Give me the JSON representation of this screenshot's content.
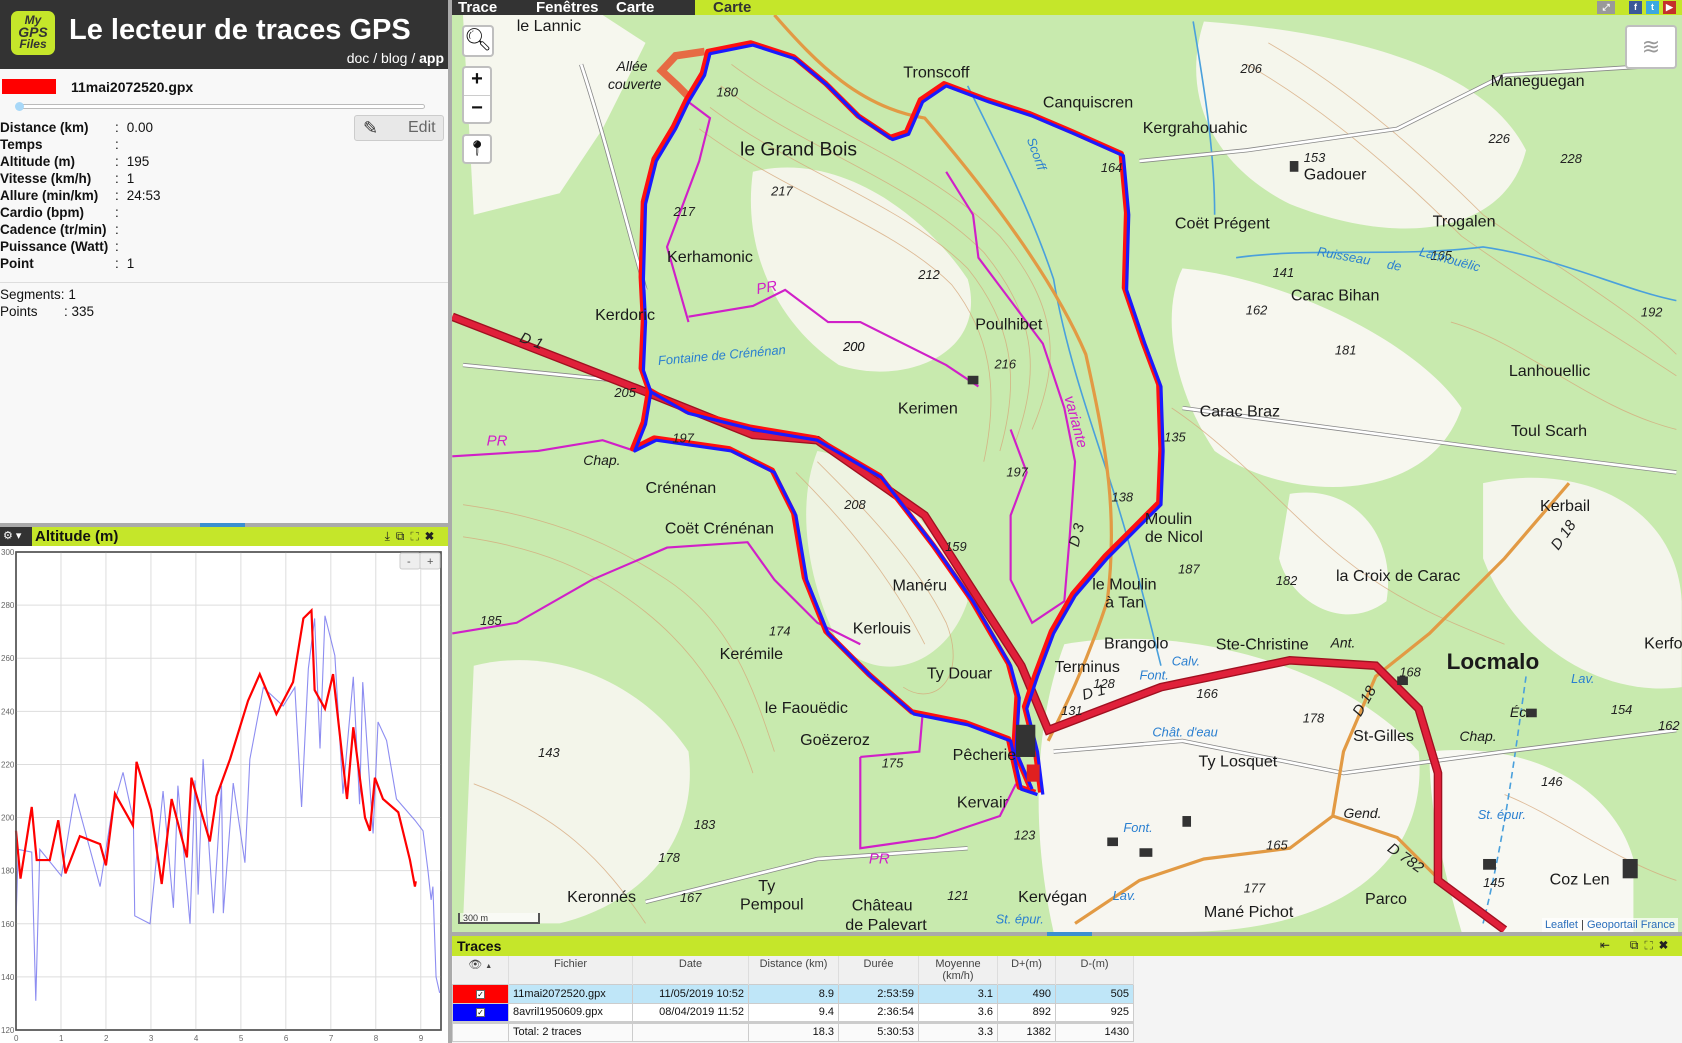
{
  "header": {
    "logo": [
      "My",
      "GPS",
      "Files"
    ],
    "title": "Le lecteur de traces GPS",
    "links": {
      "doc": "doc",
      "blog": "blog",
      "app": "app",
      "sep": "/"
    }
  },
  "track": {
    "filename": "11mai2072520.gpx",
    "color": "#ff0000",
    "edit_label": "Edit",
    "slider_position": 0
  },
  "stats": [
    {
      "label": "Distance (km)",
      "value": "0.00"
    },
    {
      "label": "Temps",
      "value": ""
    },
    {
      "label": "Altitude (m)",
      "value": "195"
    },
    {
      "label": "Vitesse (km/h)",
      "value": "1"
    },
    {
      "label": "Allure (min/km)",
      "value": "24:53"
    },
    {
      "label": "Cardio (bpm)",
      "value": ""
    },
    {
      "label": "Cadence (tr/min)",
      "value": ""
    },
    {
      "label": "Puissance (Watt)",
      "value": ""
    },
    {
      "label": "Point",
      "value": "1"
    }
  ],
  "summary": {
    "segments_label": "Segments",
    "segments": "1",
    "points_label": "Points",
    "points": "335"
  },
  "altitude_panel": {
    "title": "Altitude (m)",
    "zoom_out": "-",
    "zoom_in": "+"
  },
  "chart_data": {
    "type": "line",
    "title": "Altitude (m)",
    "xlabel": "",
    "ylabel": "",
    "xlim": [
      0,
      9.45
    ],
    "ylim": [
      120,
      300
    ],
    "xticks": [
      "0",
      "1",
      "2",
      "3",
      "4",
      "5",
      "6",
      "7",
      "8",
      "9"
    ],
    "yticks": [
      "120",
      "140",
      "160",
      "180",
      "200",
      "220",
      "240",
      "260",
      "280",
      "300"
    ],
    "grid": true,
    "series": [
      {
        "name": "11mai2072520.gpx",
        "color": "#ff0000",
        "points": [
          [
            0,
            195
          ],
          [
            0.1,
            177
          ],
          [
            0.35,
            204
          ],
          [
            0.46,
            184
          ],
          [
            0.75,
            184
          ],
          [
            0.94,
            199
          ],
          [
            1.1,
            179
          ],
          [
            1.42,
            193
          ],
          [
            1.87,
            190
          ],
          [
            2.0,
            182
          ],
          [
            2.2,
            209
          ],
          [
            2.6,
            197
          ],
          [
            2.68,
            221
          ],
          [
            3.0,
            203
          ],
          [
            3.24,
            175
          ],
          [
            3.46,
            207
          ],
          [
            3.8,
            185
          ],
          [
            3.9,
            215
          ],
          [
            4.31,
            191
          ],
          [
            4.46,
            208
          ],
          [
            4.76,
            222
          ],
          [
            5.16,
            244
          ],
          [
            5.42,
            254
          ],
          [
            5.79,
            239
          ],
          [
            6.16,
            251
          ],
          [
            6.39,
            275
          ],
          [
            6.57,
            278
          ],
          [
            6.64,
            248
          ],
          [
            6.87,
            241
          ],
          [
            7.05,
            254
          ],
          [
            7.36,
            207
          ],
          [
            7.5,
            234
          ],
          [
            7.76,
            200
          ],
          [
            7.87,
            195
          ],
          [
            7.98,
            215
          ],
          [
            8.16,
            207
          ],
          [
            8.5,
            202
          ],
          [
            8.76,
            184
          ],
          [
            8.87,
            174
          ],
          [
            8.89,
            176
          ]
        ]
      },
      {
        "name": "8avril1950609.gpx",
        "color": "#7070ee",
        "points": [
          [
            0,
            161
          ],
          [
            0.05,
            188
          ],
          [
            0.35,
            187
          ],
          [
            0.44,
            131
          ],
          [
            0.53,
            188
          ],
          [
            1.01,
            178
          ],
          [
            1.31,
            209
          ],
          [
            1.87,
            174
          ],
          [
            2.13,
            202
          ],
          [
            2.38,
            217
          ],
          [
            2.61,
            199
          ],
          [
            2.64,
            163
          ],
          [
            2.98,
            160
          ],
          [
            3.27,
            210
          ],
          [
            3.5,
            166
          ],
          [
            3.6,
            212
          ],
          [
            3.87,
            160
          ],
          [
            3.98,
            214
          ],
          [
            4.05,
            171
          ],
          [
            4.16,
            222
          ],
          [
            4.39,
            164
          ],
          [
            4.57,
            212
          ],
          [
            4.61,
            164
          ],
          [
            4.83,
            213
          ],
          [
            5.09,
            183
          ],
          [
            5.2,
            222
          ],
          [
            5.5,
            249
          ],
          [
            5.94,
            242
          ],
          [
            6.2,
            249
          ],
          [
            6.35,
            204
          ],
          [
            6.5,
            256
          ],
          [
            6.64,
            275
          ],
          [
            6.76,
            226
          ],
          [
            6.87,
            276
          ],
          [
            7.09,
            261
          ],
          [
            7.27,
            209
          ],
          [
            7.5,
            253
          ],
          [
            7.64,
            205
          ],
          [
            7.71,
            251
          ],
          [
            7.94,
            194
          ],
          [
            8.05,
            236
          ],
          [
            8.24,
            229
          ],
          [
            8.46,
            207
          ],
          [
            8.87,
            199
          ],
          [
            9.05,
            195
          ],
          [
            9.16,
            180
          ],
          [
            9.23,
            169
          ],
          [
            9.27,
            174
          ],
          [
            9.34,
            140
          ],
          [
            9.42,
            134
          ]
        ]
      }
    ]
  },
  "menu": {
    "tabs": [
      "Trace",
      "Fenêtres",
      "Carte"
    ],
    "active_panel": "Carte"
  },
  "map": {
    "places": [
      "le Lannic",
      "Allée",
      "couverte",
      "Tronscoff",
      "Canquiscren",
      "le Grand Bois",
      "Kergrahouahic",
      "Maneguegan",
      "Gadouer",
      "Coët Prégent",
      "Trogalen",
      "Kerhamonic",
      "Carac Bihan",
      "Kerdoric",
      "Poulhibet",
      "Lanhouellic",
      "Kerimen",
      "Carac Braz",
      "Toul Scarh",
      "Chap.",
      "Crénénan",
      "Kerbail",
      "Moulin",
      "de Nicol",
      "Coët Crénénan",
      "la Croix de Carac",
      "Manéru",
      "le Moulin",
      "à Tan",
      "Kerlouis",
      "Brangolo",
      "Ste-Christine",
      "Locmalo",
      "Kerémile",
      "Terminus",
      "Ty Douar",
      "le Faouëdic",
      "St-Gilles",
      "Goëzeroz",
      "Pêcherie",
      "Ty Losquet",
      "Kervair",
      "Keronnés",
      "Ty",
      "Pempoul",
      "Château",
      "de Palevart",
      "Kervégan",
      "Mané Pichot",
      "Parco",
      "Coz Len",
      "Kerfor",
      "Chap.",
      "Gend.",
      "Ant.",
      "Éc."
    ],
    "heights": [
      "180",
      "217",
      "217",
      "212",
      "200",
      "216",
      "197",
      "208",
      "159",
      "174",
      "175",
      "183",
      "178",
      "121",
      "206",
      "153",
      "226",
      "228",
      "165",
      "141",
      "162",
      "181",
      "164",
      "135",
      "138",
      "187",
      "182",
      "166",
      "143",
      "185",
      "205",
      "168",
      "178",
      "146",
      "145",
      "154",
      "162",
      "192",
      "200",
      "123",
      "131",
      "128",
      "197",
      "167",
      "165",
      "177"
    ],
    "roads": [
      "D 1",
      "D 1",
      "D 3",
      "D 18",
      "D 18",
      "D 782",
      "PR",
      "PR",
      "PR",
      "variante"
    ],
    "water": [
      "Fontaine de Crénénan",
      "Scorff",
      "Ruisseau",
      "de",
      "Lanhouëlic",
      "St. épur.",
      "Lav.",
      "Font.",
      "Calv.",
      "Chât. d'eau",
      "St. épur.",
      "Lav.",
      "Font."
    ],
    "scale": "300 m",
    "attribution": {
      "leaflet": "Leaflet",
      "sep": " | ",
      "provider": "Geoportail France"
    }
  },
  "traces": {
    "title": "Traces",
    "columns": [
      "Fichier",
      "Date",
      "Distance (km)",
      "Durée",
      "Moyenne (km/h)",
      "D+(m)",
      "D-(m)"
    ],
    "rows": [
      {
        "color": "#ff0000",
        "visible": true,
        "file": "11mai2072520.gpx",
        "date": "11/05/2019 10:52",
        "distance": "8.9",
        "duration": "2:53:59",
        "avg": "3.1",
        "dplus": "490",
        "dminus": "505"
      },
      {
        "color": "#0000ff",
        "visible": true,
        "file": "8avril1950609.gpx",
        "date": "08/04/2019 11:52",
        "distance": "9.4",
        "duration": "2:36:54",
        "avg": "3.6",
        "dplus": "892",
        "dminus": "925"
      }
    ],
    "total": {
      "label": "Total: 2 traces",
      "distance": "18.3",
      "duration": "5:30:53",
      "avg": "3.3",
      "dplus": "1382",
      "dminus": "1430"
    }
  }
}
